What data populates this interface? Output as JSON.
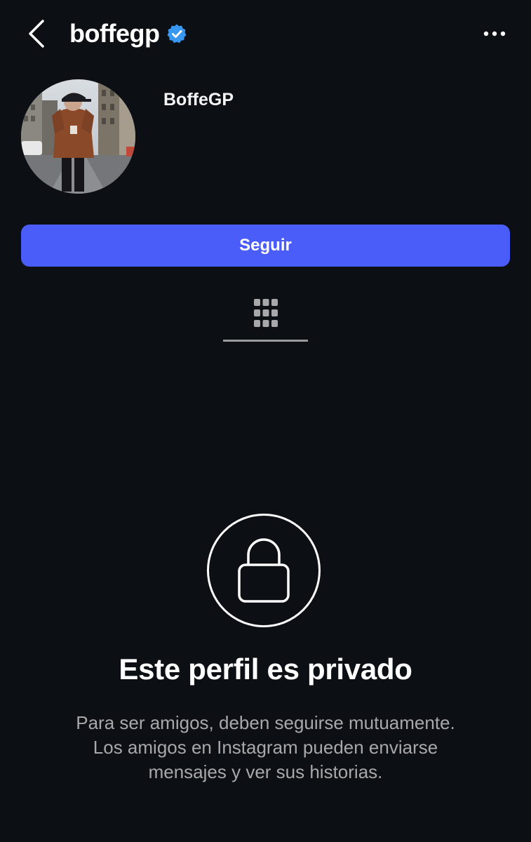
{
  "header": {
    "username": "boffegp",
    "verified": true,
    "back_icon": "chevron-left-icon",
    "more_icon": "more-horizontal-icon"
  },
  "profile": {
    "display_name": "BoffeGP",
    "avatar_icon": "profile-photo"
  },
  "actions": {
    "follow_label": "Seguir"
  },
  "tabs": {
    "active": "grid",
    "grid_icon": "grid-icon"
  },
  "private_notice": {
    "lock_icon": "lock-icon",
    "title": "Este perfil es privado",
    "description_lines": [
      "Para ser amigos, deben seguirse mutuamente.",
      "Los amigos en Instagram pueden enviarse",
      "mensajes y ver sus historias."
    ]
  },
  "colors": {
    "background": "#0c1014",
    "accent": "#4a5df9",
    "verified": "#3897f0",
    "secondary_text": "#a8a8ab"
  }
}
